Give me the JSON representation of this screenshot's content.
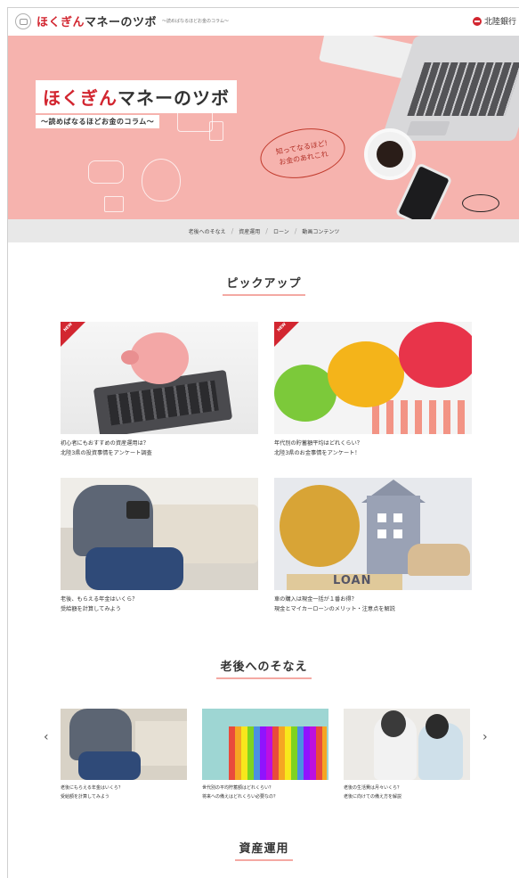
{
  "header": {
    "logo_red": "ほくぎん",
    "logo_black": "マネーのツボ",
    "logo_sub": "〜読めばなるほどお金のコラム〜",
    "bank_name": "北陸銀行"
  },
  "hero": {
    "title_red": "ほくぎん",
    "title_black": "マネーのツボ",
    "subtitle": "〜読めばなるほどお金のコラム〜",
    "bubble_line1": "知ってなるほど!",
    "bubble_line2": "お金のあれこれ",
    "background_color": "#f6b3ae"
  },
  "nav": {
    "items": [
      "老後へのそなえ",
      "資産運用",
      "ローン",
      "動画コンテンツ"
    ],
    "separator": "/"
  },
  "pickup": {
    "title": "ピックアップ",
    "new_label": "NEW",
    "cards": [
      {
        "line1": "初心者にもおすすめの資産運用は？",
        "line2": "北陸3県の投資事情をアンケート調査"
      },
      {
        "line1": "年代別の貯蓄額平均はどれくらい？",
        "line2": "北陸3県のお金事情をアンケート！"
      },
      {
        "line1": "老後、もらえる年金はいくら？",
        "line2": "受給額を計算してみよう"
      },
      {
        "line1": "車の購入は現金一括が１番お得？",
        "line2": "現金とマイカーローンのメリット・注意点を解説"
      }
    ]
  },
  "retirement": {
    "title": "老後へのそなえ",
    "prev_arrow": "‹",
    "next_arrow": "›",
    "cards": [
      {
        "line1": "老後にもらえる年金はいくら？",
        "line2": "受給額を計算してみよう"
      },
      {
        "line1": "世代別の平均貯蓄額はどれくらい？",
        "line2": "将来への備えはどれくらい必要なの？"
      },
      {
        "line1": "老後の生活費は月々いくら？",
        "line2": "老後に向けての備え方を解説"
      }
    ]
  },
  "assets": {
    "title": "資産運用"
  },
  "colors": {
    "brand_red": "#d22630",
    "accent_pink": "#f4a9a3",
    "nav_bg": "#e8e8e8"
  }
}
